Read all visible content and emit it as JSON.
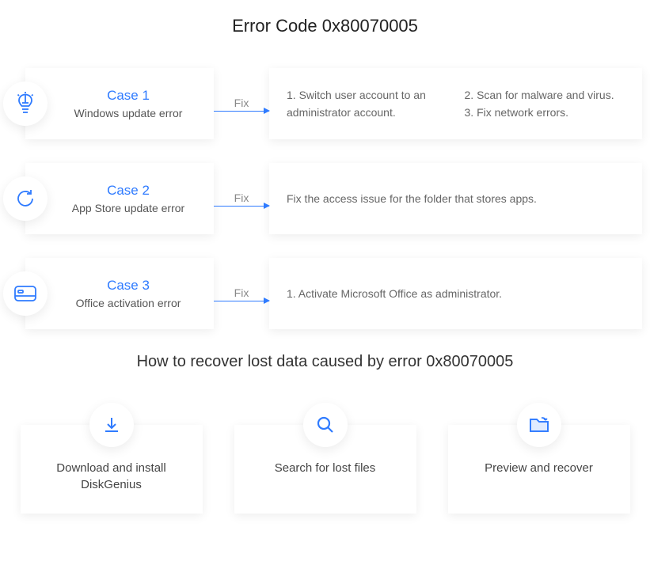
{
  "title": "Error Code 0x80070005",
  "fix_label": "Fix",
  "cases": [
    {
      "icon": "bulb",
      "title": "Case 1",
      "subtitle": "Windows update error",
      "fixes_col1": "1. Switch user account to an administrator account.",
      "fixes_col2_a": "2. Scan for malware and virus.",
      "fixes_col2_b": "3. Fix network errors."
    },
    {
      "icon": "refresh",
      "title": "Case 2",
      "subtitle": "App Store update error",
      "fix_single": "Fix the access issue for the folder that stores apps."
    },
    {
      "icon": "card",
      "title": "Case 3",
      "subtitle": "Office activation error",
      "fix_single": "1. Activate Microsoft Office as administrator."
    }
  ],
  "recovery_title": "How to recover lost data caused by error 0x80070005",
  "steps": [
    {
      "icon": "download",
      "label": "Download and install DiskGenius"
    },
    {
      "icon": "search",
      "label": "Search for lost files"
    },
    {
      "icon": "folder",
      "label": "Preview and recover"
    }
  ]
}
